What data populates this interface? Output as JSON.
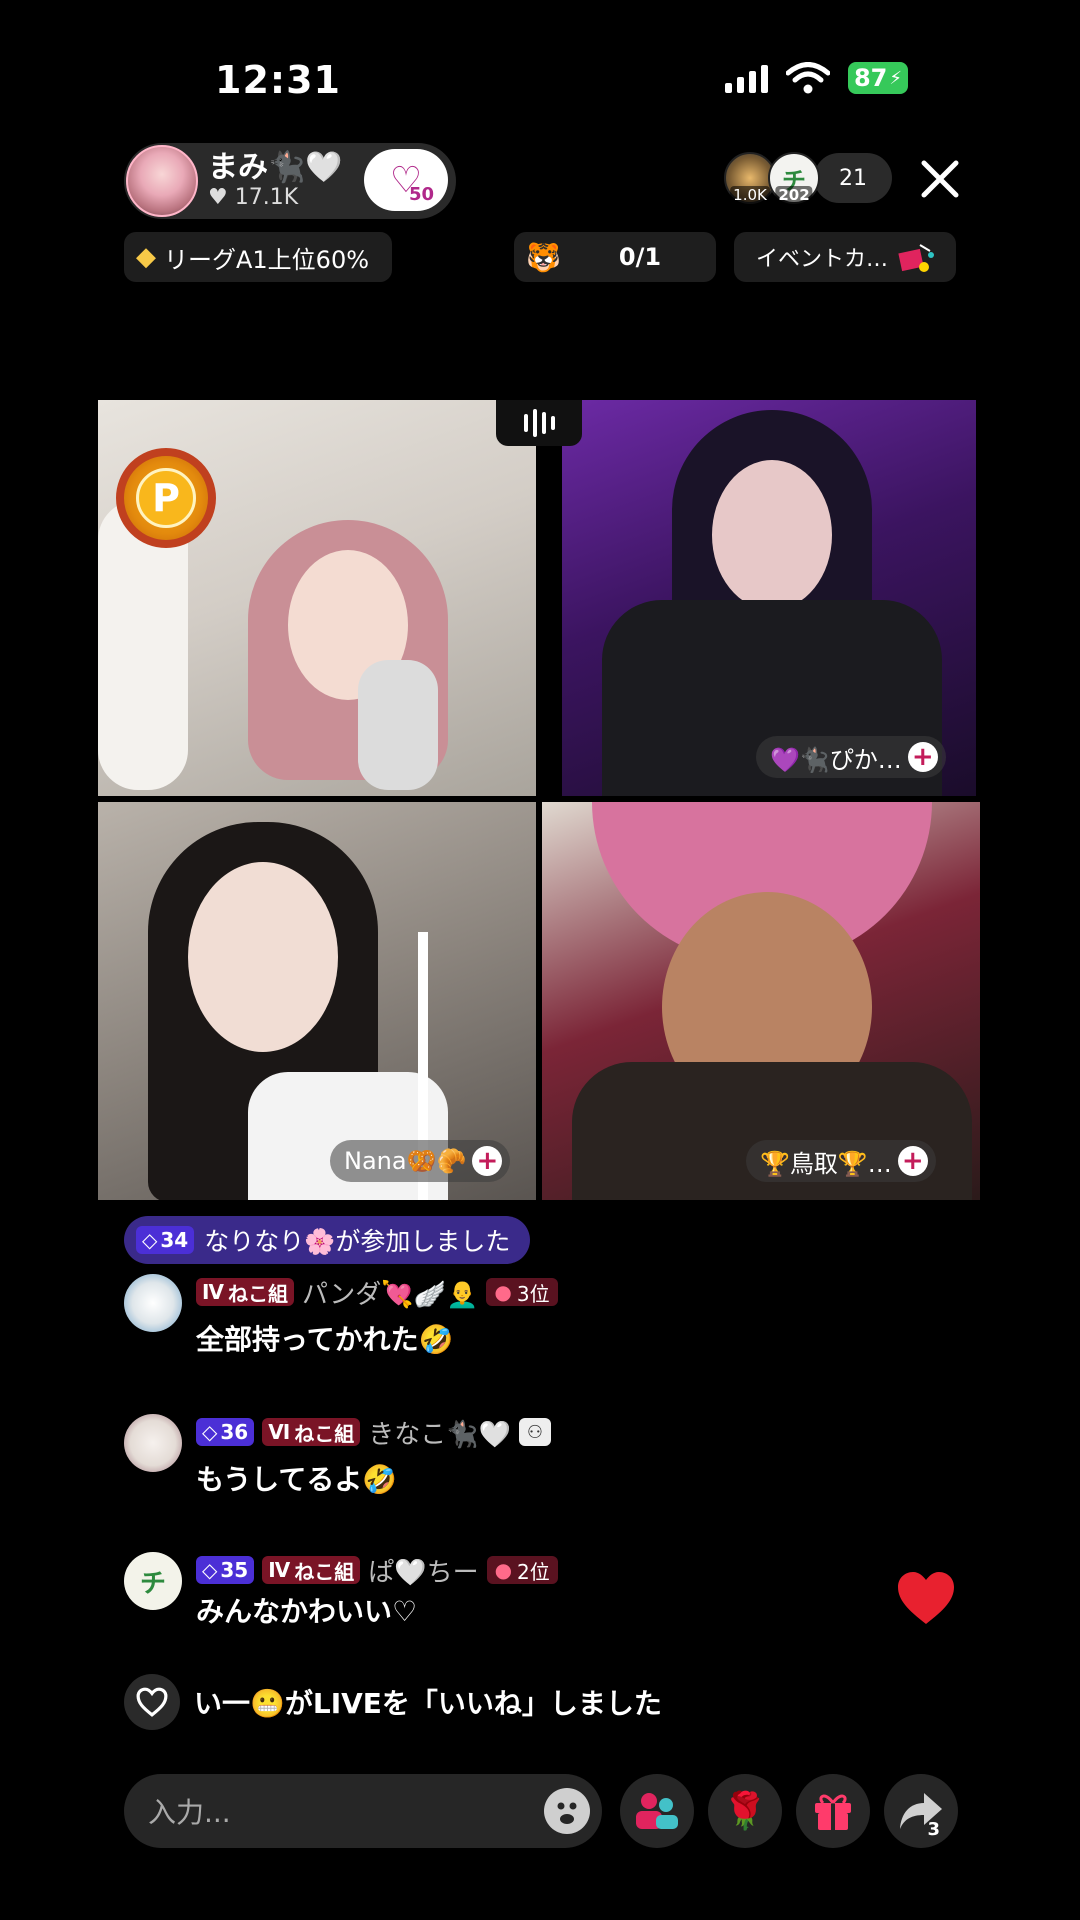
{
  "status_bar": {
    "time": "12:31",
    "battery": "87"
  },
  "host": {
    "name": "まみ🐈‍⬛🤍",
    "likes": "♥ 17.1K",
    "badge_level": "50"
  },
  "viewers": {
    "top1_score": "1.0K",
    "top2_initial": "チ",
    "top2_score": "202",
    "count": "21"
  },
  "league": {
    "label": "リーグA1上位60%"
  },
  "mission": {
    "value": "0/1"
  },
  "event": {
    "label": "イベントカ…"
  },
  "tiles": [
    {
      "name": ""
    },
    {
      "name": "💜🐈‍⬛ぴか…"
    },
    {
      "name": "Nana🥨🥐"
    },
    {
      "name": "🏆鳥取🏆…"
    }
  ],
  "join": {
    "level": "34",
    "text": "なりなり🌸が参加しました"
  },
  "messages": [
    {
      "level": "",
      "team_level": "Ⅳ",
      "team": "ねこ組",
      "user": "パンダ💘🪽👨‍🦲",
      "rank": "3位",
      "text": "全部持ってかれた🤣"
    },
    {
      "level": "36",
      "team_level": "Ⅵ",
      "team": "ねこ組",
      "user": "きなこ🐈‍⬛🤍",
      "rank": "",
      "text": "もうしてるよ🤣"
    },
    {
      "level": "35",
      "team_level": "Ⅳ",
      "team": "ねこ組",
      "user": "ぱ🤍ちー",
      "rank": "2位",
      "text": "みんなかわいい♡"
    }
  ],
  "like_notice": {
    "text": "い一😬がLIVEを「いいね」しました"
  },
  "input": {
    "placeholder": "入力..."
  },
  "share_count": "3",
  "colors": {
    "accent": "#e0245e",
    "join_banner": "#3a2a8a",
    "battery": "#36c95a"
  }
}
